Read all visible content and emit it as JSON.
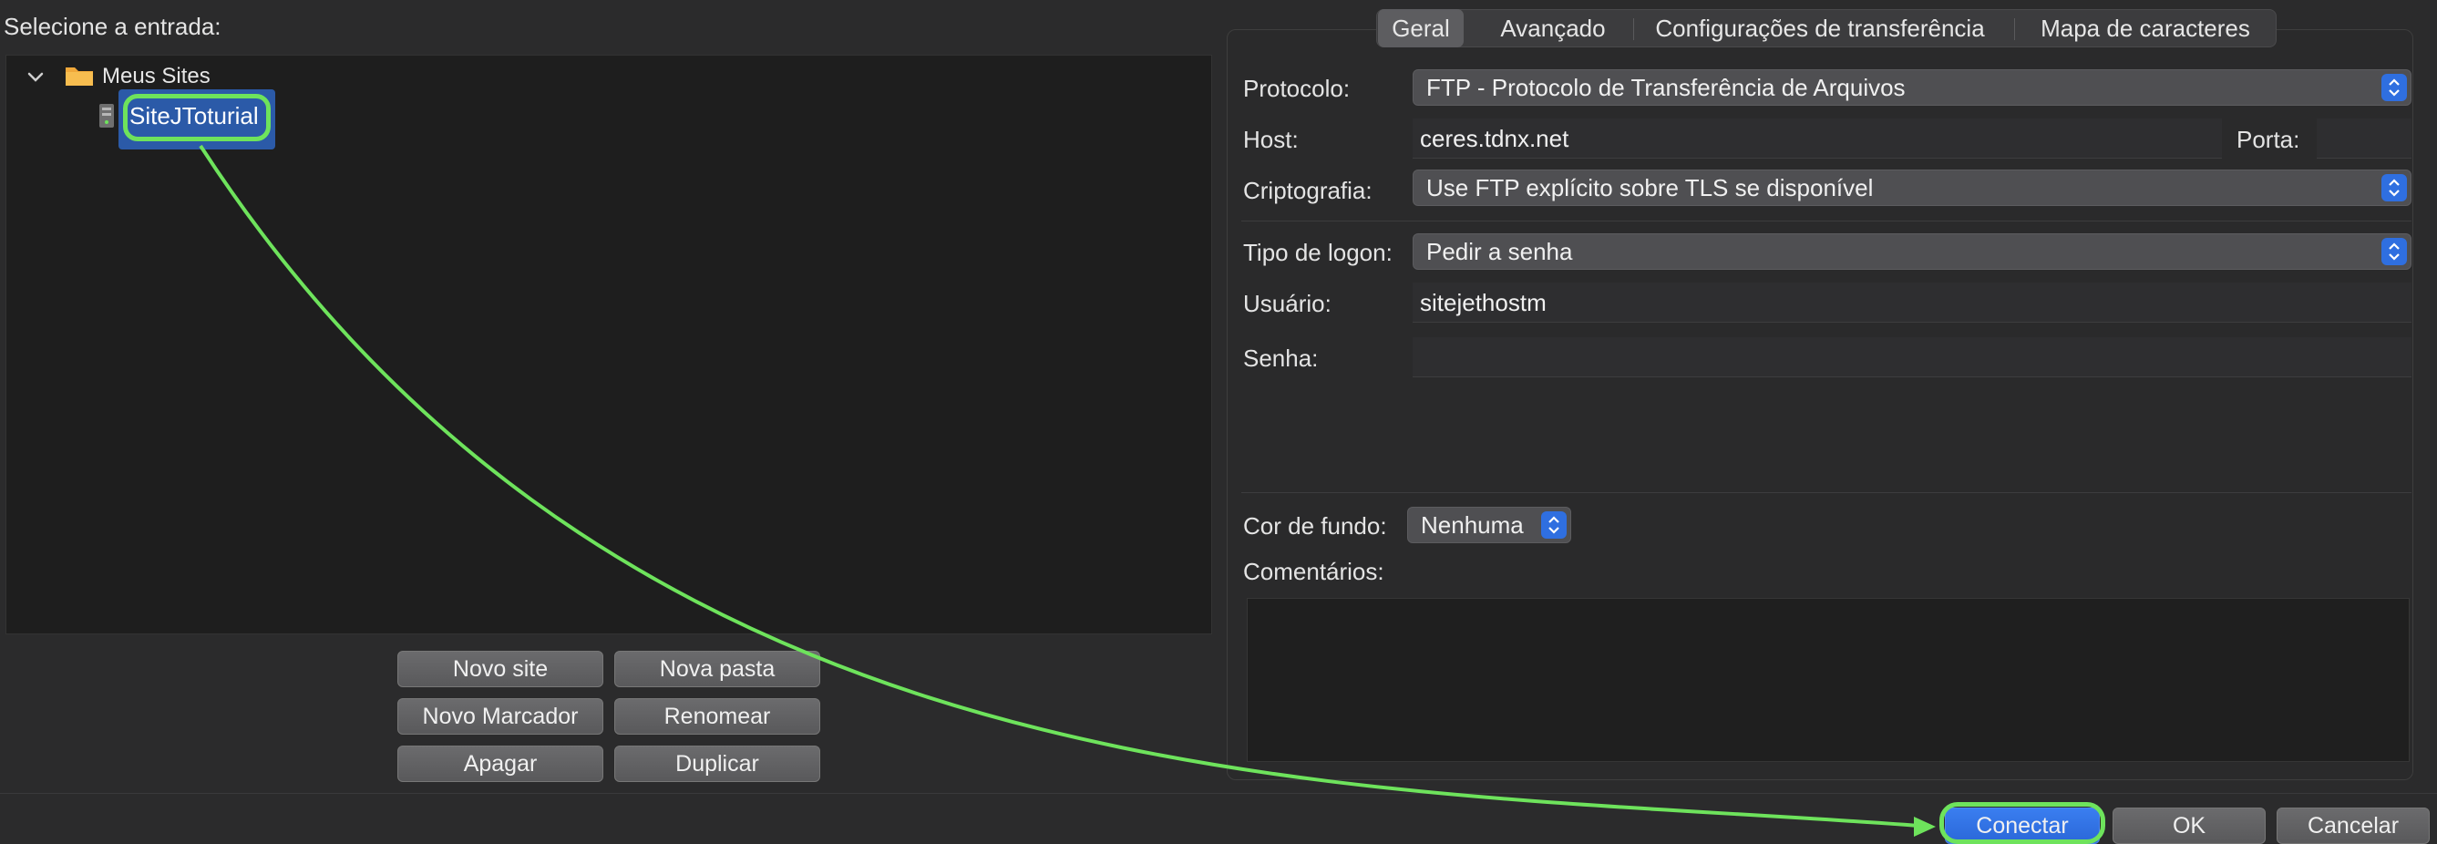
{
  "left": {
    "heading": "Selecione a entrada:",
    "tree": {
      "root_label": "Meus Sites",
      "selected_site": "SiteJToturial"
    },
    "buttons": {
      "new_site": "Novo site",
      "new_folder": "Nova pasta",
      "new_bookmark": "Novo Marcador",
      "rename": "Renomear",
      "delete": "Apagar",
      "duplicate": "Duplicar"
    }
  },
  "tabs": [
    "Geral",
    "Avançado",
    "Configurações de transferência",
    "Mapa de caracteres"
  ],
  "selected_tab": "Geral",
  "form": {
    "protocol_label": "Protocolo:",
    "protocol_value": "FTP - Protocolo de Transferência de Arquivos",
    "host_label": "Host:",
    "host_value": "ceres.tdnx.net",
    "port_label": "Porta:",
    "port_value": "",
    "encryption_label": "Criptografia:",
    "encryption_value": "Use FTP explícito sobre TLS se disponível",
    "logon_label": "Tipo de logon:",
    "logon_value": "Pedir a senha",
    "user_label": "Usuário:",
    "user_value": "sitejethostm",
    "password_label": "Senha:",
    "password_value": "",
    "bgcolor_label": "Cor de fundo:",
    "bgcolor_value": "Nenhuma",
    "comments_label": "Comentários:",
    "comments_value": ""
  },
  "footer": {
    "connect": "Conectar",
    "ok": "OK",
    "cancel": "Cancelar"
  },
  "colors": {
    "annotation": "#6ee35c",
    "accent": "#2f6fe0",
    "selection": "#2b5aa8"
  },
  "icons": [
    "chevron-down-icon",
    "folder-icon",
    "server-icon",
    "select-stepper-icon"
  ]
}
